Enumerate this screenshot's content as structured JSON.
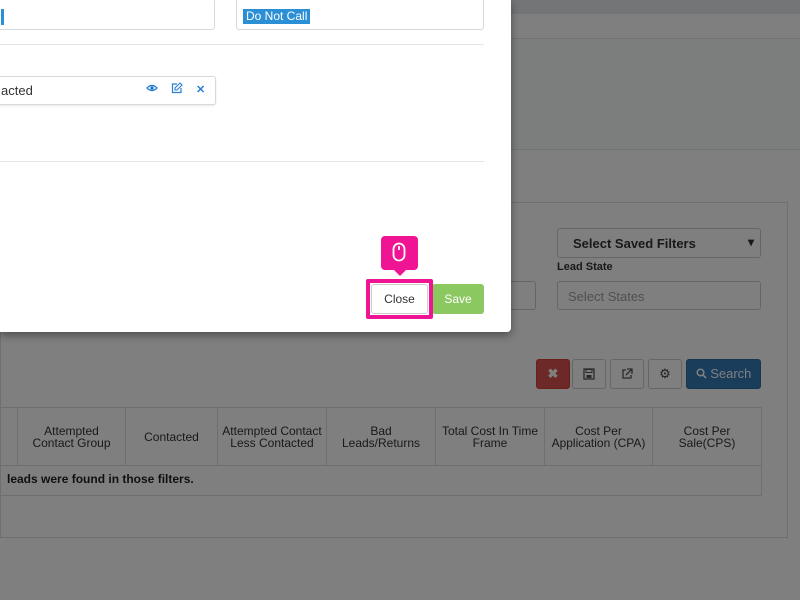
{
  "modal": {
    "tag_do_not_call": "Do Not Call",
    "group_row_text": "acted",
    "row_icons": [
      "eye-icon",
      "edit-icon",
      "close-icon"
    ],
    "close_label": "Close",
    "save_label": "Save"
  },
  "background": {
    "saved_filters_label": "Select Saved Filters",
    "lead_state_label": "Lead State",
    "states_placeholder": "Select States",
    "search_label": "Search",
    "table": {
      "headers": [
        "",
        "Attempted Contact Group",
        "Contacted",
        "Attempted Contact Less Contacted",
        "Bad Leads/Returns",
        "Total Cost In Time Frame",
        "Cost Per Application (CPA)",
        "Cost Per Sale(CPS)"
      ],
      "empty_message": "leads were found in those filters."
    }
  },
  "colors": {
    "highlight": "#ef1493",
    "save_green": "#8bc860",
    "search_blue": "#337ab7",
    "clear_red": "#d9534f",
    "tag_blue": "#2b8fd6"
  }
}
